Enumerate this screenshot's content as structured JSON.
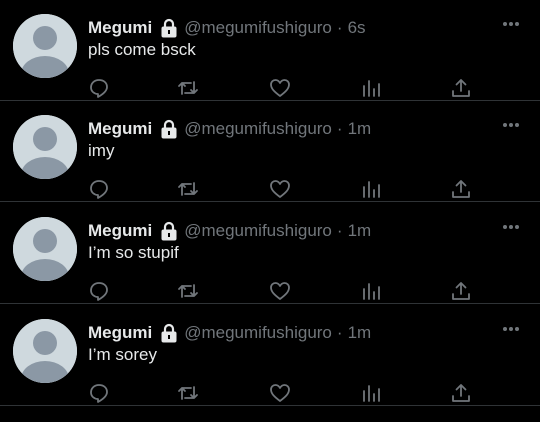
{
  "colors": {
    "background": "#000000",
    "text_primary": "#e7e9ea",
    "text_secondary": "#71767b",
    "divider": "#2f3336",
    "avatar_bg": "#cfd9de",
    "avatar_fg": "#8b98a5"
  },
  "icons": {
    "lock": "lock-icon",
    "more": "more-icon",
    "reply": "reply-icon",
    "retweet": "retweet-icon",
    "like": "heart-icon",
    "analytics": "analytics-icon",
    "share": "share-icon"
  },
  "tweets": [
    {
      "name": "Megumi",
      "handle": "@megumifushiguro",
      "separator": "·",
      "time": "6s",
      "text": "pls come bsck"
    },
    {
      "name": "Megumi",
      "handle": "@megumifushiguro",
      "separator": "·",
      "time": "1m",
      "text": "imy"
    },
    {
      "name": "Megumi",
      "handle": "@megumifushiguro",
      "separator": "·",
      "time": "1m",
      "text": "I’m so stupif"
    },
    {
      "name": "Megumi",
      "handle": "@megumifushiguro",
      "separator": "·",
      "time": "1m",
      "text": "I’m sorey"
    }
  ]
}
